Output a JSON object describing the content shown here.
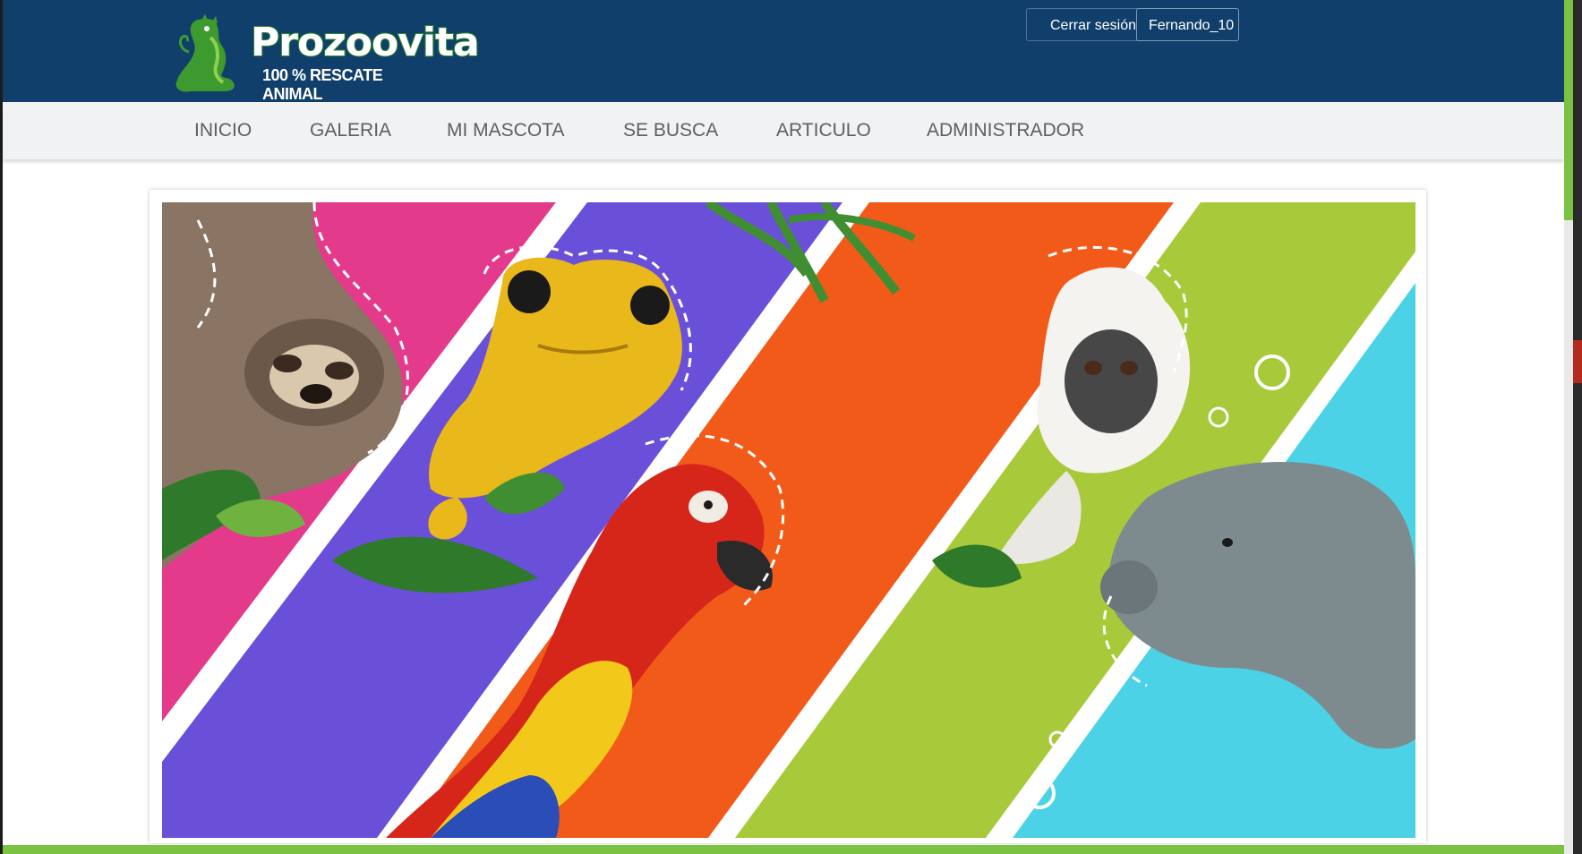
{
  "header": {
    "logo_name": "Prozoovita",
    "logo_tagline": "100 % RESCATE ANIMAL",
    "logout_label": "Cerrar sesión",
    "username": "Fernando_10"
  },
  "nav": {
    "items": [
      {
        "label": "INICIO"
      },
      {
        "label": "GALERIA"
      },
      {
        "label": "MI MASCOTA"
      },
      {
        "label": "SE BUSCA"
      },
      {
        "label": "ARTICULO"
      },
      {
        "label": "ADMINISTRADOR"
      }
    ]
  },
  "banner": {
    "icons": [
      "sloth-image",
      "frog-image",
      "macaw-image",
      "tamarin-image",
      "manatee-image"
    ]
  },
  "colors": {
    "header_bg": "#113f6b",
    "nav_bg": "#f1f2f3",
    "accent_green": "#7bc142",
    "stripe_pink": "#e33a8c",
    "stripe_purple": "#6a4fd8",
    "stripe_orange": "#f25a1a",
    "stripe_lime": "#a8c93a",
    "stripe_cyan": "#4cd2e6"
  }
}
